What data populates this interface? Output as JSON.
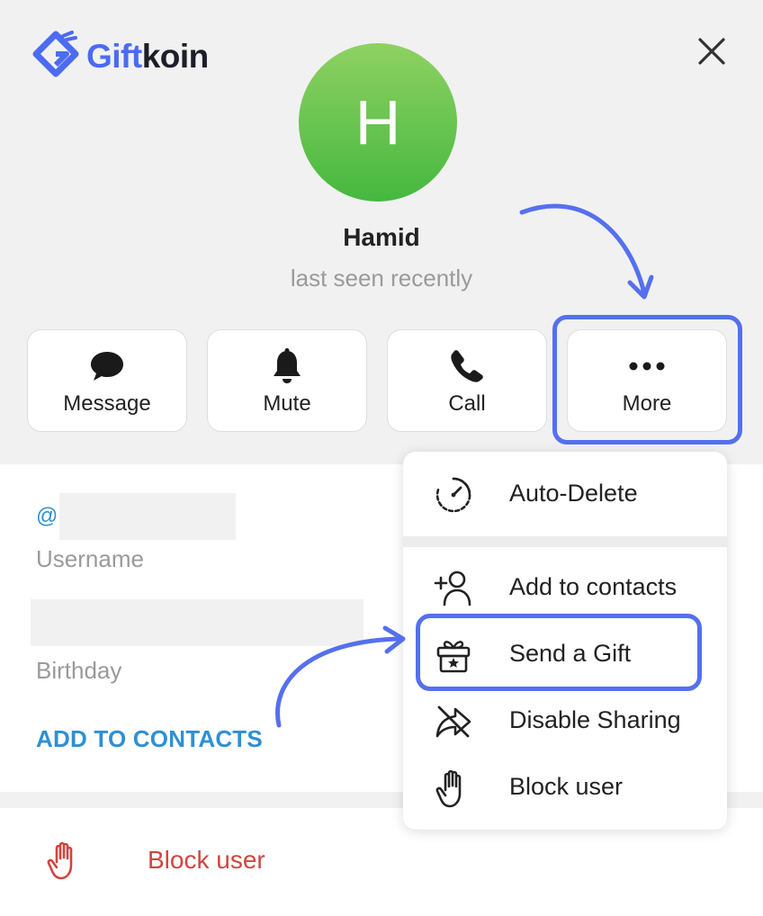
{
  "brand": {
    "name_part1": "Gift",
    "name_part2": "koin",
    "color": "#4b6bf2"
  },
  "profile": {
    "avatar_initial": "H",
    "name": "Hamid",
    "status": "last seen recently"
  },
  "actions": [
    {
      "label": "Message",
      "icon": "chat-bubble-icon"
    },
    {
      "label": "Mute",
      "icon": "bell-icon"
    },
    {
      "label": "Call",
      "icon": "phone-icon"
    },
    {
      "label": "More",
      "icon": "more-dots-icon"
    }
  ],
  "info": {
    "username_prefix": "@",
    "username_label": "Username",
    "birthday_label": "Birthday",
    "add_to_contacts": "ADD TO CONTACTS"
  },
  "bottom": {
    "block_user": "Block user"
  },
  "menu": {
    "items": [
      {
        "label": "Auto-Delete",
        "icon": "timer-icon"
      },
      {
        "label": "Add to contacts",
        "icon": "add-user-icon"
      },
      {
        "label": "Send a Gift",
        "icon": "gift-icon"
      },
      {
        "label": "Disable Sharing",
        "icon": "share-off-icon"
      },
      {
        "label": "Block user",
        "icon": "hand-icon"
      }
    ]
  },
  "colors": {
    "highlight": "#5570ee",
    "link": "#2f8fd3",
    "danger": "#d0453f",
    "avatar": "#5cc04a"
  }
}
